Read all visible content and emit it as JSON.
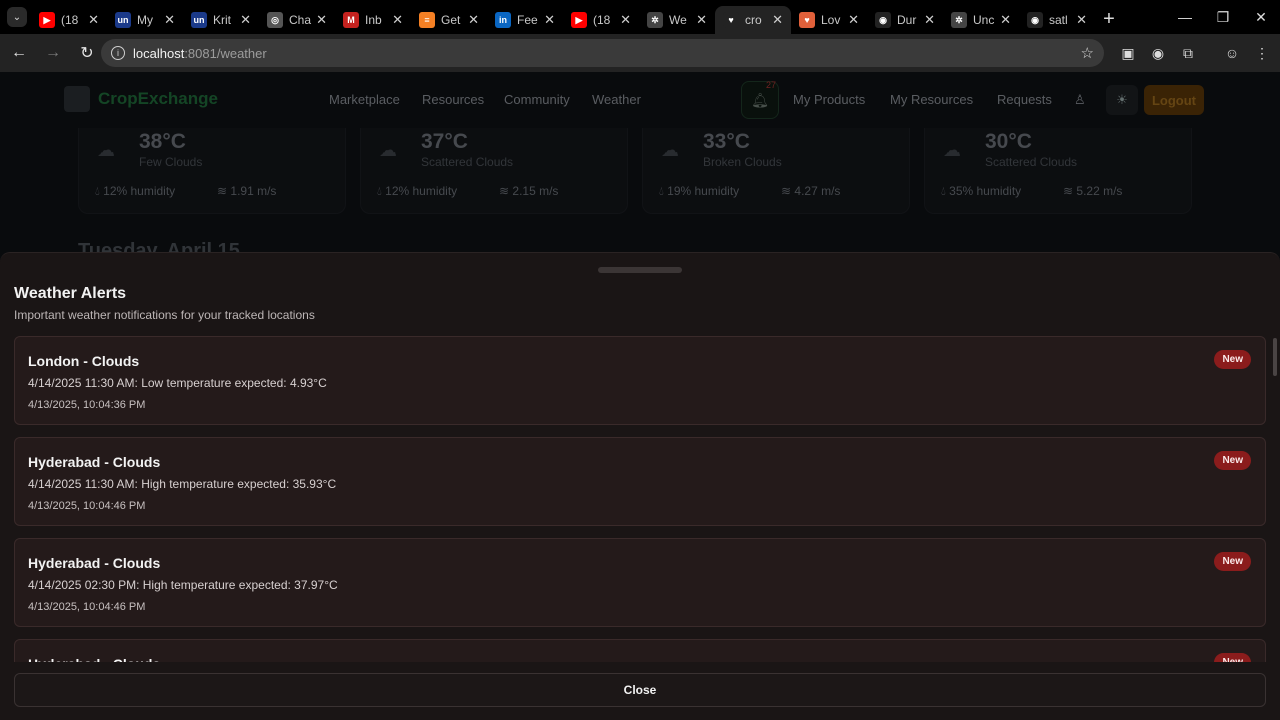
{
  "browser": {
    "tabs": [
      {
        "title": "(18",
        "icon": "youtube-icon",
        "color": "#ff0000",
        "glyph": "▶"
      },
      {
        "title": "My",
        "icon": "unstop-icon",
        "color": "#1b3a8a",
        "glyph": "un"
      },
      {
        "title": "Krit",
        "icon": "unstop-icon",
        "color": "#1b3a8a",
        "glyph": "un"
      },
      {
        "title": "Cha",
        "icon": "globe-icon",
        "color": "#555555",
        "glyph": "◎"
      },
      {
        "title": "Inb",
        "icon": "gmail-icon",
        "color": "#c5221f",
        "glyph": "M"
      },
      {
        "title": "Get",
        "icon": "stackoverflow-icon",
        "color": "#f48024",
        "glyph": "≡"
      },
      {
        "title": "Fee",
        "icon": "linkedin-icon",
        "color": "#0a66c2",
        "glyph": "in"
      },
      {
        "title": "(18",
        "icon": "youtube-icon",
        "color": "#ff0000",
        "glyph": "▶"
      },
      {
        "title": "We",
        "icon": "openai-icon",
        "color": "#444444",
        "glyph": "✲"
      },
      {
        "title": "cro",
        "icon": "heart-icon",
        "color": "#232323",
        "glyph": "♥"
      },
      {
        "title": "Lov",
        "icon": "lovable-icon",
        "color": "#e0603a",
        "glyph": "♥"
      },
      {
        "title": "Dur",
        "icon": "github-icon",
        "color": "#222222",
        "glyph": "◉"
      },
      {
        "title": "Unc",
        "icon": "openai-icon",
        "color": "#444444",
        "glyph": "✲"
      },
      {
        "title": "satl",
        "icon": "github-icon",
        "color": "#222222",
        "glyph": "◉"
      }
    ],
    "active_tab_index": 9,
    "url_host": "localhost",
    "url_path": ":8081/weather"
  },
  "app": {
    "brand": "CropExchange",
    "nav": [
      "Marketplace",
      "Resources",
      "Community",
      "Weather"
    ],
    "notification_count": "27",
    "right_nav": [
      "My Products",
      "My Resources",
      "Requests"
    ],
    "logout": "Logout",
    "forecast_cards": [
      {
        "temp": "38°C",
        "desc": "Few Clouds",
        "humidity": "12% humidity",
        "wind": "1.91 m/s"
      },
      {
        "temp": "37°C",
        "desc": "Scattered Clouds",
        "humidity": "12% humidity",
        "wind": "2.15 m/s"
      },
      {
        "temp": "33°C",
        "desc": "Broken Clouds",
        "humidity": "19% humidity",
        "wind": "4.27 m/s"
      },
      {
        "temp": "30°C",
        "desc": "Scattered Clouds",
        "humidity": "35% humidity",
        "wind": "5.22 m/s"
      }
    ],
    "day_heading": "Tuesday, April 15"
  },
  "drawer": {
    "title": "Weather Alerts",
    "subtitle": "Important weather notifications for your tracked locations",
    "alerts": [
      {
        "title": "London - Clouds",
        "message": "4/14/2025 11:30 AM: Low temperature expected: 4.93°C",
        "time": "4/13/2025, 10:04:36 PM",
        "badge": "New"
      },
      {
        "title": "Hyderabad - Clouds",
        "message": "4/14/2025 11:30 AM: High temperature expected: 35.93°C",
        "time": "4/13/2025, 10:04:46 PM",
        "badge": "New"
      },
      {
        "title": "Hyderabad - Clouds",
        "message": "4/14/2025 02:30 PM: High temperature expected: 37.97°C",
        "time": "4/13/2025, 10:04:46 PM",
        "badge": "New"
      },
      {
        "title": "Hyderabad - Clouds",
        "message": "",
        "time": "",
        "badge": "New"
      }
    ],
    "close_label": "Close"
  }
}
